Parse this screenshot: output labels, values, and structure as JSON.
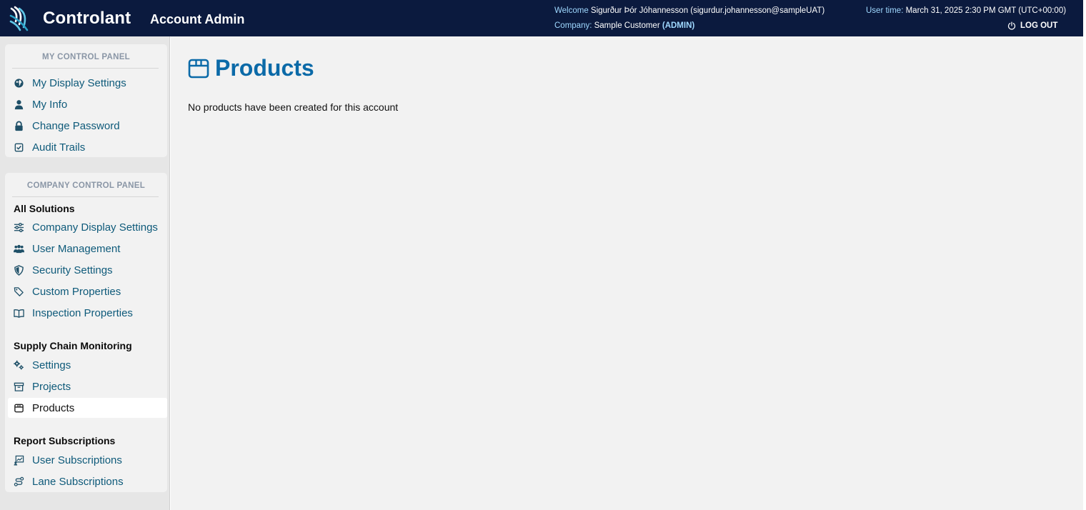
{
  "header": {
    "brand": "Controlant",
    "app_title": "Account Admin",
    "welcome_label": "Welcome",
    "welcome_user": " Sigurður Þór Jóhannesson (sigurdur.johannesson@sampleUAT)",
    "company_label": "Company:",
    "company_name": " Sample Customer ",
    "company_role": "(ADMIN)",
    "usertime_label": "User time:",
    "usertime_value": " March 31, 2025 2:30 PM GMT (UTC+00:00)",
    "logout_label": "LOG OUT"
  },
  "sidebar": {
    "my_panel_title": "MY CONTROL PANEL",
    "my_items": [
      {
        "label": "My Display Settings",
        "icon": "globe-icon"
      },
      {
        "label": "My Info",
        "icon": "user-icon"
      },
      {
        "label": "Change Password",
        "icon": "lock-icon"
      },
      {
        "label": "Audit Trails",
        "icon": "checkbox-icon"
      }
    ],
    "company_panel_title": "COMPANY CONTROL PANEL",
    "sections": [
      {
        "title": "All Solutions",
        "items": [
          {
            "label": "Company Display Settings",
            "icon": "sliders-icon"
          },
          {
            "label": "User Management",
            "icon": "users-icon"
          },
          {
            "label": "Security Settings",
            "icon": "shield-icon"
          },
          {
            "label": "Custom Properties",
            "icon": "tags-icon"
          },
          {
            "label": "Inspection Properties",
            "icon": "book-icon"
          }
        ]
      },
      {
        "title": "Supply Chain Monitoring",
        "items": [
          {
            "label": "Settings",
            "icon": "gears-icon"
          },
          {
            "label": "Projects",
            "icon": "archive-icon"
          },
          {
            "label": "Products",
            "icon": "box-icon",
            "active": true
          }
        ]
      },
      {
        "title": "Report Subscriptions",
        "items": [
          {
            "label": "User Subscriptions",
            "icon": "chart-icon"
          },
          {
            "label": "Lane Subscriptions",
            "icon": "route-icon"
          }
        ]
      }
    ]
  },
  "main": {
    "title": "Products",
    "title_icon": "box-icon",
    "empty_message": "No products have been created for this account"
  },
  "colors": {
    "header_bg": "#0b1a3e",
    "accent": "#0b6aa8",
    "link": "#0e5a7a",
    "label_cyan": "#9fd8ff"
  }
}
